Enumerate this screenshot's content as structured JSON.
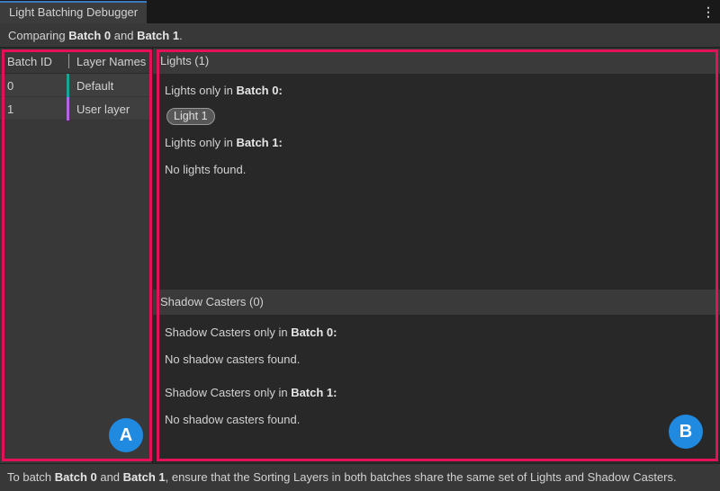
{
  "window": {
    "tab_title": "Light Batching Debugger",
    "menu_glyph": "⋮"
  },
  "compare_bar": {
    "prefix": "Comparing ",
    "batch_a": "Batch 0",
    "middle": " and ",
    "batch_b": "Batch 1",
    "suffix": "."
  },
  "batch_list": {
    "headers": {
      "id": "Batch ID",
      "names": "Layer Names"
    },
    "rows": [
      {
        "id": "0",
        "name": "Default",
        "color": "#1aa39a"
      },
      {
        "id": "1",
        "name": "User layer",
        "color": "#b066e6"
      }
    ]
  },
  "lights": {
    "header": "Lights (1)",
    "only_a_prefix": "Lights only in ",
    "only_a_batch": "Batch 0",
    "only_b_prefix": "Lights only in ",
    "only_b_batch": "Batch 1",
    "colon": ":",
    "items_a": [
      "Light 1"
    ],
    "empty_b": "No lights found."
  },
  "shadows": {
    "header": "Shadow Casters (0)",
    "only_a_prefix": "Shadow Casters only in ",
    "only_a_batch": "Batch 0",
    "only_b_prefix": "Shadow Casters only in ",
    "only_b_batch": "Batch 1",
    "colon": ":",
    "empty_a": "No shadow casters found.",
    "empty_b": "No shadow casters found."
  },
  "footer": {
    "prefix": "To batch ",
    "batch_a": "Batch 0",
    "middle": " and ",
    "batch_b": "Batch 1",
    "suffix": ", ensure that the Sorting Layers in both batches share the same set of Lights and Shadow Casters."
  },
  "callouts": {
    "a_label": "A",
    "b_label": "B",
    "highlight_color": "#e2115a",
    "badge_color": "#1f8ae0"
  }
}
